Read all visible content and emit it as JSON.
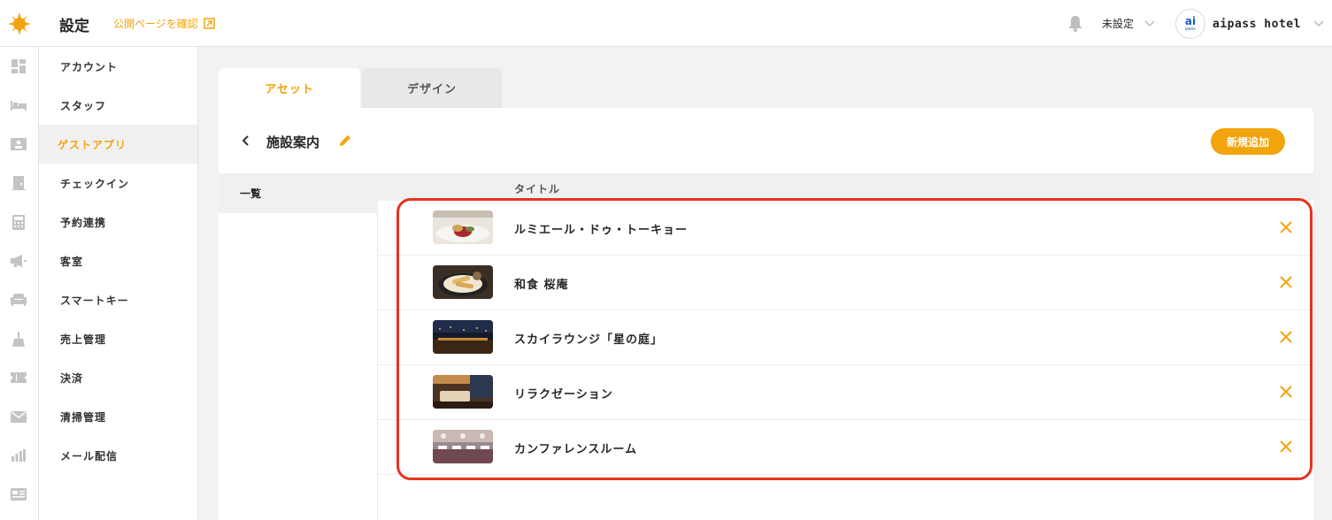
{
  "header": {
    "title": "設定",
    "public_link": "公開ページを確認",
    "status": "未設定",
    "hotel_name": "aipass hotel",
    "avatar_top": "ai",
    "avatar_bottom": "pass"
  },
  "rail": {
    "icons": [
      "dashboard-icon",
      "bed-icon",
      "id-card-icon",
      "door-icon",
      "calculator-icon",
      "megaphone-icon",
      "sofa-icon",
      "broom-icon",
      "ticket-icon",
      "mail-icon",
      "bar-chart-icon",
      "newspaper-icon"
    ]
  },
  "menu": {
    "items": [
      {
        "label": "アカウント"
      },
      {
        "label": "スタッフ"
      },
      {
        "label": "ゲストアプリ"
      },
      {
        "label": "チェックイン"
      },
      {
        "label": "予約連携"
      },
      {
        "label": "客室"
      },
      {
        "label": "スマートキー"
      },
      {
        "label": "売上管理"
      },
      {
        "label": "決済"
      },
      {
        "label": "清掃管理"
      },
      {
        "label": "メール配信"
      }
    ],
    "active_index": 2
  },
  "tabs": [
    {
      "label": "アセット"
    },
    {
      "label": "デザイン"
    }
  ],
  "section": {
    "title": "施設案内",
    "add_button": "新規追加",
    "list_tab": "一覧",
    "column_title": "タイトル"
  },
  "rows": [
    {
      "title": "ルミエール・ドゥ・トーキョー",
      "thumb": "food-plate"
    },
    {
      "title": "和食 桜庵",
      "thumb": "tempura"
    },
    {
      "title": "スカイラウンジ「星の庭」",
      "thumb": "night-lounge"
    },
    {
      "title": "リラクゼーション",
      "thumb": "spa-room"
    },
    {
      "title": "カンファレンスルーム",
      "thumb": "banquet-hall"
    }
  ],
  "colors": {
    "accent": "#f2a40e",
    "highlight": "#e8321e"
  }
}
